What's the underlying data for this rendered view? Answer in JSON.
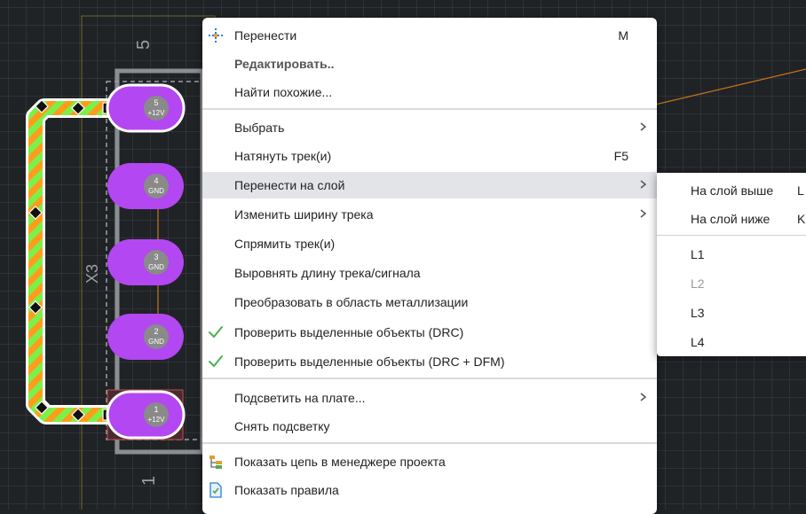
{
  "canvas": {
    "component_ref": "X3",
    "pin_top_label": "5",
    "pin_bottom_label": "1",
    "pads": [
      {
        "num": "5",
        "net": "+12V"
      },
      {
        "num": "4",
        "net": "GND"
      },
      {
        "num": "3",
        "net": "GND"
      },
      {
        "num": "2",
        "net": "GND"
      },
      {
        "num": "1",
        "net": "+12V"
      }
    ],
    "colors": {
      "pad": "#b347f2",
      "track_green": "#7cf04a",
      "track_orange": "#ff9d1a",
      "ratsnest": "#c8751a",
      "background": "#202326"
    }
  },
  "context_menu": {
    "items": [
      {
        "label": "Перенести",
        "shortcut": "M",
        "icon": "move-icon"
      },
      {
        "label": "Редактировать.."
      },
      {
        "label": "Найти похожие..."
      },
      {
        "label": "Выбрать",
        "submenu": true
      },
      {
        "label": "Натянуть трек(и)",
        "shortcut": "F5"
      },
      {
        "label": "Перенести на слой",
        "submenu": true,
        "highlighted": true
      },
      {
        "label": "Изменить ширину трека",
        "submenu": true
      },
      {
        "label": "Спрямить трек(и)"
      },
      {
        "label": "Выровнять длину трека/сигнала"
      },
      {
        "label": "Преобразовать в область металлизации"
      },
      {
        "label": "Проверить выделенные объекты (DRC)",
        "icon": "checkmark-icon"
      },
      {
        "label": "Проверить выделенные объекты (DRC + DFM)",
        "icon": "checkmark-icon"
      },
      {
        "label": "Подсветить на плате...",
        "submenu": true
      },
      {
        "label": "Снять подсветку"
      },
      {
        "label": "Показать цепь в менеджере проекта",
        "icon": "project-tree-icon"
      },
      {
        "label": "Показать правила",
        "icon": "rules-document-icon"
      }
    ]
  },
  "submenu": {
    "items": [
      {
        "label": "На слой выше",
        "shortcut": "L"
      },
      {
        "label": "На слой ниже",
        "shortcut": "K"
      },
      {
        "label": "L1"
      },
      {
        "label": "L2",
        "disabled": true
      },
      {
        "label": "L3"
      },
      {
        "label": "L4"
      }
    ]
  },
  "accent_colors": {
    "check": "#4caf50",
    "menu_highlight": "#e2e4e7"
  }
}
